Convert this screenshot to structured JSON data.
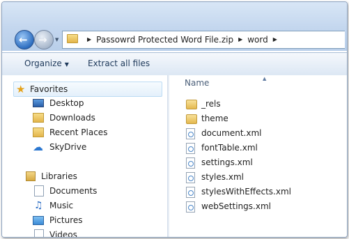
{
  "address": {
    "segments": [
      "Passowrd Protected Word File.zip",
      "word"
    ]
  },
  "toolbar": {
    "organize_label": "Organize",
    "extract_label": "Extract all files"
  },
  "nav": {
    "favorites_label": "Favorites",
    "favorites": [
      {
        "label": "Desktop",
        "icon": "desktop-icon"
      },
      {
        "label": "Downloads",
        "icon": "downloads-folder-icon"
      },
      {
        "label": "Recent Places",
        "icon": "recent-places-icon"
      },
      {
        "label": "SkyDrive",
        "icon": "skydrive-cloud-icon"
      }
    ],
    "libraries_label": "Libraries",
    "libraries": [
      {
        "label": "Documents",
        "icon": "documents-icon"
      },
      {
        "label": "Music",
        "icon": "music-icon"
      },
      {
        "label": "Pictures",
        "icon": "pictures-icon"
      },
      {
        "label": "Videos",
        "icon": "videos-icon"
      }
    ]
  },
  "files": {
    "column_name": "Name",
    "items": [
      {
        "name": "_rels",
        "type": "folder"
      },
      {
        "name": "theme",
        "type": "folder"
      },
      {
        "name": "document.xml",
        "type": "xml"
      },
      {
        "name": "fontTable.xml",
        "type": "xml"
      },
      {
        "name": "settings.xml",
        "type": "xml"
      },
      {
        "name": "styles.xml",
        "type": "xml"
      },
      {
        "name": "stylesWithEffects.xml",
        "type": "xml"
      },
      {
        "name": "webSettings.xml",
        "type": "xml"
      }
    ]
  },
  "colors": {
    "title_gradient_top": "#d8e6f6",
    "selection": "#e4f0fb",
    "link_text": "#1e395b"
  }
}
